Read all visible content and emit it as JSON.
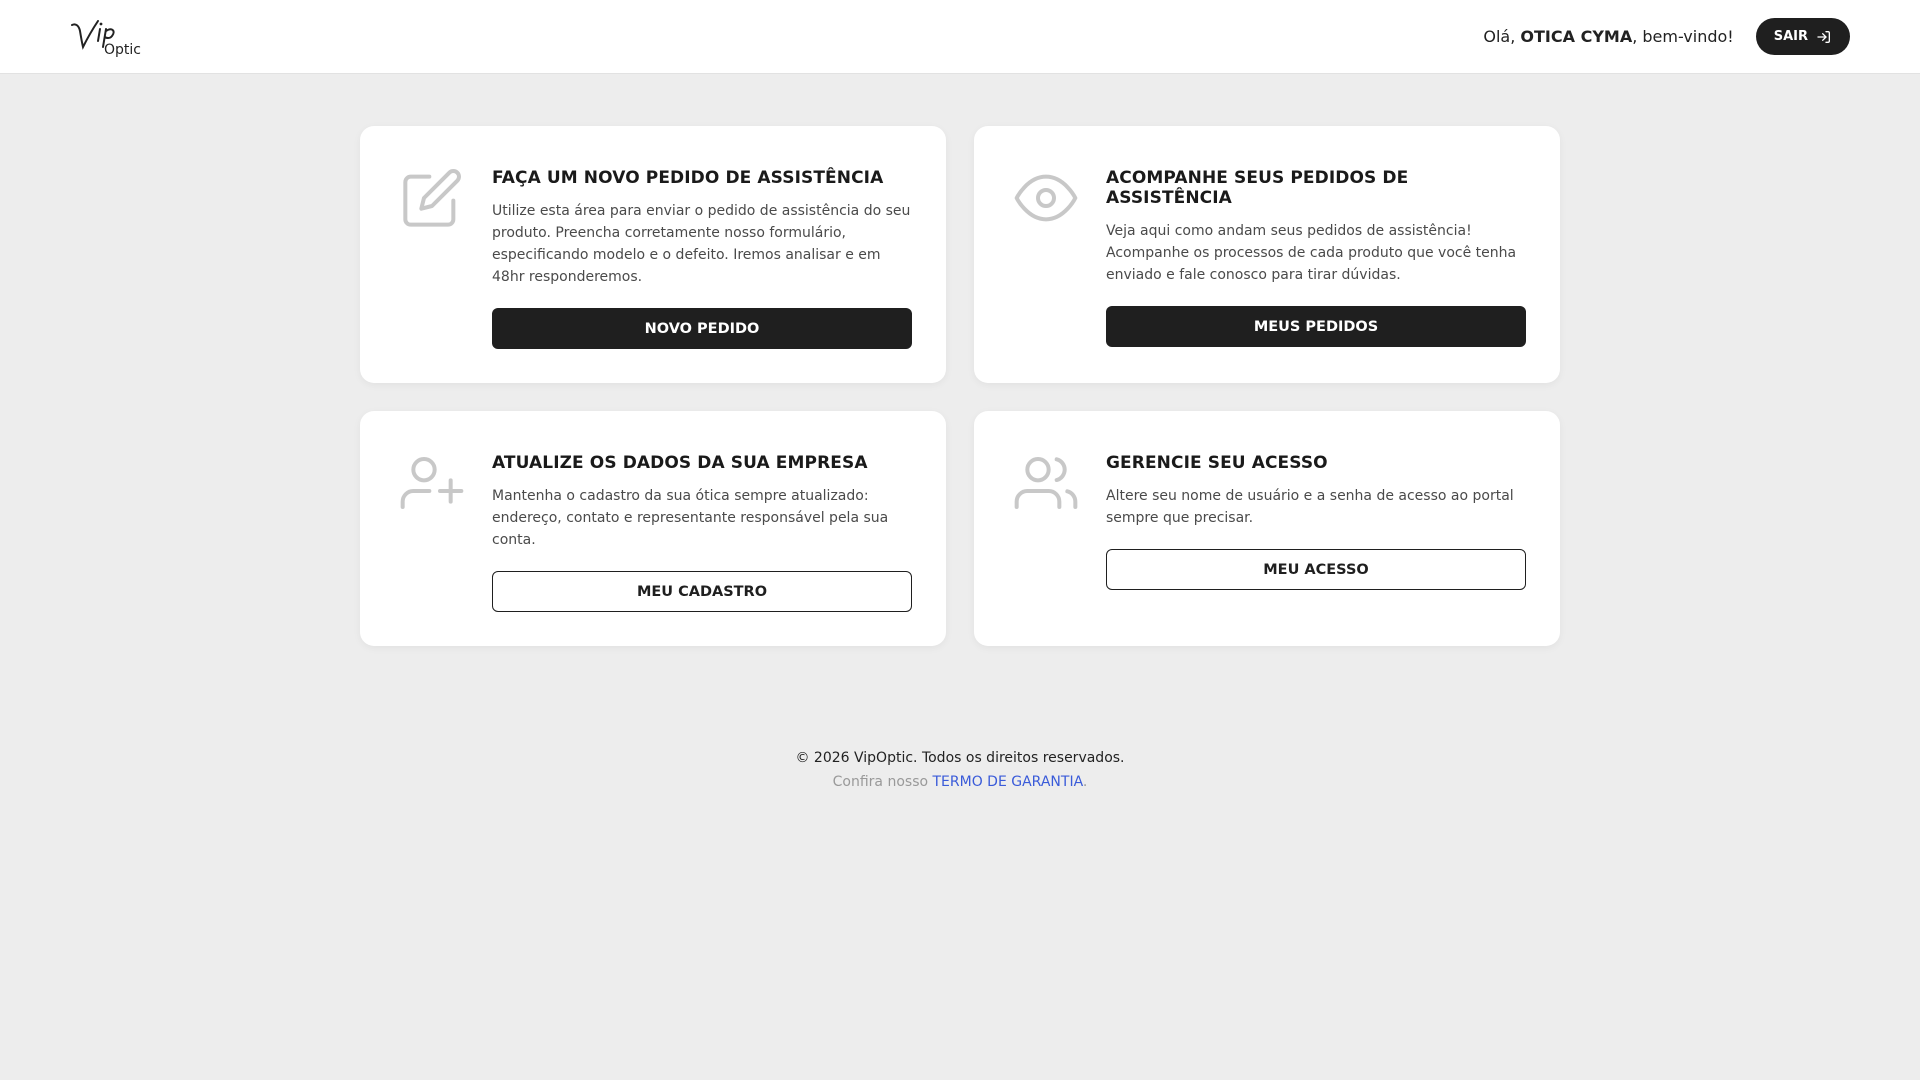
{
  "header": {
    "logo_text": "VipOptic",
    "greeting_prefix": "Olá, ",
    "company_name": "OTICA CYMA",
    "greeting_suffix": ", bem-vindo!",
    "logout_label": "SAIR",
    "logout_icon": "logout-arrow-icon"
  },
  "cards": [
    {
      "icon": "edit-icon",
      "title": "FAÇA UM NOVO PEDIDO DE ASSISTÊNCIA",
      "text": "Utilize esta área para enviar o pedido de assistência do seu produto. Preencha corretamente nosso formulário, especificando modelo e o defeito. Iremos analisar e em 48hr responderemos.",
      "button": "NOVO PEDIDO"
    },
    {
      "icon": "eye-icon",
      "title": "ACOMPANHE SEUS PEDIDOS DE ASSISTÊNCIA",
      "text": "Veja aqui como andam seus pedidos de assistência! Acompanhe os processos de cada produto que você tenha enviado e fale conosco para tirar dúvidas.",
      "button": "MEUS PEDIDOS"
    },
    {
      "icon": "user-plus-icon",
      "title": "ATUALIZE OS DADOS DA SUA EMPRESA",
      "text": "Mantenha o cadastro da sua ótica sempre atualizado: endereço, contato e representante responsável pela sua conta.",
      "button": "MEU CADASTRO"
    },
    {
      "icon": "users-icon",
      "title": "GERENCIE SEU ACESSO",
      "text": "Altere seu nome de usuário e a senha de acesso ao portal sempre que precisar.",
      "button": "MEU ACESSO"
    }
  ],
  "footer": {
    "copyright": "© 2026 VipOptic. Todos os direitos reservados.",
    "terms_prefix": "Confira nosso ",
    "terms_link": "TERMO DE GARANTIA",
    "terms_suffix": "."
  },
  "colors": {
    "background": "#ededed",
    "card": "#ffffff",
    "dark_button": "#1f1f1f",
    "icon_gray": "#c8c8c8",
    "link_blue": "#3a5bd9"
  }
}
